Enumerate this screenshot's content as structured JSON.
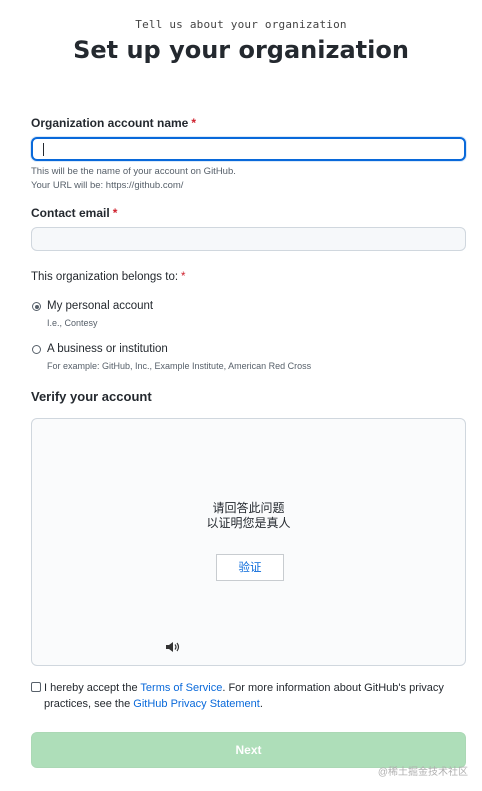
{
  "header": {
    "subtitle": "Tell us about your organization",
    "title": "Set up your organization"
  },
  "form": {
    "account_name": {
      "label": "Organization account name",
      "required": "*",
      "value": "",
      "note1": "This will be the name of your account on GitHub.",
      "note2": "Your URL will be: https://github.com/"
    },
    "contact_email": {
      "label": "Contact email",
      "required": "*",
      "value": ""
    },
    "belongs_to": {
      "label": "This organization belongs to:",
      "required": "*",
      "options": [
        {
          "label": "My personal account",
          "note": "I.e., Contesy",
          "checked": true
        },
        {
          "label": "A business or institution",
          "note": "For example: GitHub, Inc., Example Institute, American Red Cross",
          "checked": false
        }
      ]
    }
  },
  "verify": {
    "heading": "Verify your account",
    "prompt_line1": "请回答此问题",
    "prompt_line2": "以证明您是真人",
    "button": "验证",
    "audio_icon": "speaker-icon"
  },
  "terms": {
    "prefix": "I hereby accept the ",
    "tos_link": "Terms of Service",
    "middle": ". For more information about GitHub's privacy practices, see the ",
    "privacy_link": "GitHub Privacy Statement",
    "suffix": "."
  },
  "next_button": "Next",
  "watermark": "@稀土掘金技术社区",
  "colors": {
    "accent": "#0969da",
    "required": "#cf222e",
    "next_disabled": "#94d3a2"
  }
}
